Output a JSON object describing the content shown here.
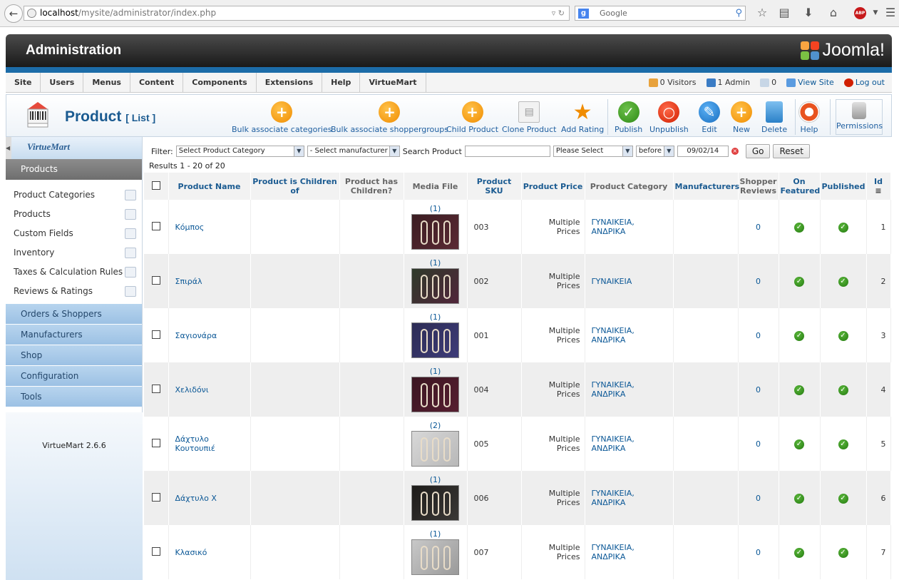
{
  "browser": {
    "url_host": "localhost",
    "url_path": "/mysite/administrator/index.php",
    "search_placeholder": "Google",
    "search_engine_letter": "g",
    "abp_label": "ABP"
  },
  "header": {
    "title": "Administration",
    "logo_text": "Joomla!"
  },
  "menu": {
    "items": [
      "Site",
      "Users",
      "Menus",
      "Content",
      "Components",
      "Extensions",
      "Help",
      "VirtueMart"
    ],
    "visitors": "0 Visitors",
    "admins": "1 Admin",
    "messages": "0",
    "view_site": "View Site",
    "logout": "Log out"
  },
  "toolbar": {
    "title": "Product",
    "subtitle": "[ List ]",
    "buttons": {
      "bulk_categories": "Bulk associate categories",
      "bulk_shoppergroups": "Bulk associate shoppergroups",
      "child_product": "Child Product",
      "clone_product": "Clone Product",
      "add_rating": "Add Rating",
      "publish": "Publish",
      "unpublish": "Unpublish",
      "edit": "Edit",
      "new": "New",
      "delete": "Delete",
      "help": "Help",
      "permissions": "Permissions"
    }
  },
  "sidebar": {
    "logo_text": "VirtueMart",
    "active_section": "Products",
    "items": [
      "Product Categories",
      "Products",
      "Custom Fields",
      "Inventory",
      "Taxes & Calculation Rules",
      "Reviews & Ratings"
    ],
    "sections": [
      "Orders & Shoppers",
      "Manufacturers",
      "Shop",
      "Configuration",
      "Tools"
    ],
    "version": "VirtueMart 2.6.6"
  },
  "filter": {
    "label": "Filter:",
    "category_select": "Select Product Category",
    "manufacturer_select": "- Select manufacturer -",
    "search_label": "Search Product",
    "search_value": "",
    "date_select": "Please Select",
    "before_select": "before",
    "date_value": "09/02/14",
    "go_label": "Go",
    "reset_label": "Reset",
    "results": "Results 1 - 20 of 20"
  },
  "table": {
    "headers": {
      "name": "Product Name",
      "is_child": "Product is Children of",
      "has_children": "Product has Children?",
      "media": "Media File",
      "sku": "Product SKU",
      "price": "Product Price",
      "category": "Product Category",
      "manufacturers": "Manufacturers",
      "reviews": "Shopper Reviews",
      "featured": "On Featured",
      "published": "Published",
      "id": "Id"
    },
    "rows": [
      {
        "name": "Κόμπος",
        "media_count": "(1)",
        "sku": "003",
        "price": "Multiple Prices",
        "category": "ΓΥΝΑΙΚΕΙΑ, ΑΝΔΡΙΚΑ",
        "reviews": "0",
        "id": "1"
      },
      {
        "name": "Σπιράλ",
        "media_count": "(1)",
        "sku": "002",
        "price": "Multiple Prices",
        "category": "ΓΥΝΑΙΚΕΙΑ",
        "reviews": "0",
        "id": "2"
      },
      {
        "name": "Σαγιονάρα",
        "media_count": "(1)",
        "sku": "001",
        "price": "Multiple Prices",
        "category": "ΓΥΝΑΙΚΕΙΑ, ΑΝΔΡΙΚΑ",
        "reviews": "0",
        "id": "3"
      },
      {
        "name": "Χελιδόνι",
        "media_count": "(1)",
        "sku": "004",
        "price": "Multiple Prices",
        "category": "ΓΥΝΑΙΚΕΙΑ, ΑΝΔΡΙΚΑ",
        "reviews": "0",
        "id": "4"
      },
      {
        "name": "Δάχτυλο Κουτουπιέ",
        "media_count": "(2)",
        "sku": "005",
        "price": "Multiple Prices",
        "category": "ΓΥΝΑΙΚΕΙΑ, ΑΝΔΡΙΚΑ",
        "reviews": "0",
        "id": "5"
      },
      {
        "name": "Δάχτυλο Χ",
        "media_count": "(1)",
        "sku": "006",
        "price": "Multiple Prices",
        "category": "ΓΥΝΑΙΚΕΙΑ, ΑΝΔΡΙΚΑ",
        "reviews": "0",
        "id": "6"
      },
      {
        "name": "Κλασικό",
        "media_count": "(1)",
        "sku": "007",
        "price": "Multiple Prices",
        "category": "ΓΥΝΑΙΚΕΙΑ, ΑΝΔΡΙΚΑ",
        "reviews": "0",
        "id": "7"
      }
    ]
  },
  "colors": {
    "accent_blue": "#1b5b91",
    "link_blue": "#0a5796",
    "publish_green": "#2e8a15",
    "orange_button": "#f08c00",
    "header_dark": "#1a1a1a",
    "strip_blue": "#1c6ca8"
  },
  "icons": [
    "back-arrow-icon",
    "globe-icon",
    "search-magnifier-icon",
    "star-icon",
    "bookmark-list-icon",
    "download-icon",
    "home-icon",
    "menu-icon",
    "add-icon",
    "clone-icon",
    "star-rating-icon",
    "check-icon",
    "unpublish-icon",
    "edit-icon",
    "trash-icon",
    "lifebuoy-icon",
    "lock-icon",
    "sort-icon"
  ]
}
